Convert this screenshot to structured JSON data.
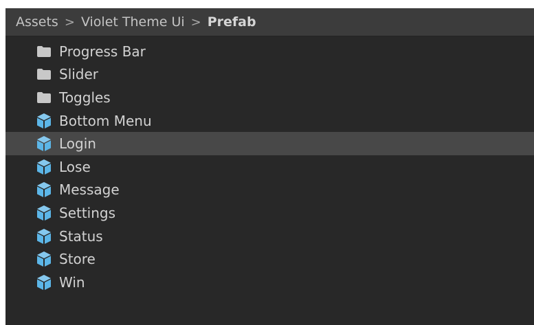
{
  "breadcrumb": {
    "items": [
      "Assets",
      "Violet Theme Ui",
      "Prefab"
    ],
    "separator": ">"
  },
  "colors": {
    "background": "#282828",
    "header": "#3c3c3c",
    "selected_row": "#484848",
    "folder_icon": "#c8c8c8",
    "prefab_icon": "#5cb6e8"
  },
  "items": [
    {
      "label": "Progress Bar",
      "icon": "folder-icon",
      "selected": false
    },
    {
      "label": "Slider",
      "icon": "folder-icon",
      "selected": false
    },
    {
      "label": "Toggles",
      "icon": "folder-icon",
      "selected": false
    },
    {
      "label": "Bottom Menu",
      "icon": "prefab-cube-icon",
      "selected": false
    },
    {
      "label": "Login",
      "icon": "prefab-cube-icon",
      "selected": true
    },
    {
      "label": "Lose",
      "icon": "prefab-cube-icon",
      "selected": false
    },
    {
      "label": "Message",
      "icon": "prefab-cube-icon",
      "selected": false
    },
    {
      "label": "Settings",
      "icon": "prefab-cube-icon",
      "selected": false
    },
    {
      "label": "Status",
      "icon": "prefab-cube-icon",
      "selected": false
    },
    {
      "label": "Store",
      "icon": "prefab-cube-icon",
      "selected": false
    },
    {
      "label": "Win",
      "icon": "prefab-cube-icon",
      "selected": false
    }
  ]
}
